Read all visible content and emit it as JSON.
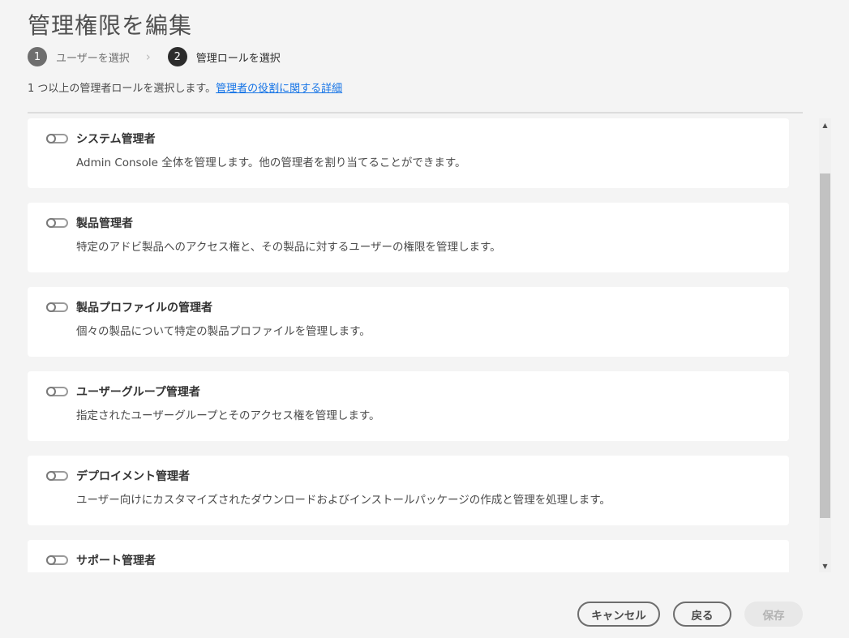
{
  "dialog": {
    "title": "管理権限を編集",
    "description": "1 つ以上の管理者ロールを選択します。",
    "link_text": "管理者の役割に関する詳細"
  },
  "steps": [
    {
      "number": "1",
      "label": "ユーザーを選択",
      "state": "done"
    },
    {
      "number": "2",
      "label": "管理ロールを選択",
      "state": "active"
    }
  ],
  "roles": [
    {
      "name": "システム管理者",
      "description": "Admin Console 全体を管理します。他の管理者を割り当てることができます。",
      "enabled": false
    },
    {
      "name": "製品管理者",
      "description": "特定のアドビ製品へのアクセス権と、その製品に対するユーザーの権限を管理します。",
      "enabled": false
    },
    {
      "name": "製品プロファイルの管理者",
      "description": "個々の製品について特定の製品プロファイルを管理します。",
      "enabled": false
    },
    {
      "name": "ユーザーグループ管理者",
      "description": "指定されたユーザーグループとそのアクセス権を管理します。",
      "enabled": false
    },
    {
      "name": "デプロイメント管理者",
      "description": "ユーザー向けにカスタマイズされたダウンロードおよびインストールパッケージの作成と管理を処理します。",
      "enabled": false
    },
    {
      "name": "サポート管理者",
      "description": "",
      "enabled": false
    }
  ],
  "buttons": {
    "cancel": "キャンセル",
    "back": "戻る",
    "save": "保存"
  },
  "colors": {
    "link": "#1473e6",
    "background": "#f4f4f4",
    "card": "#ffffff"
  }
}
